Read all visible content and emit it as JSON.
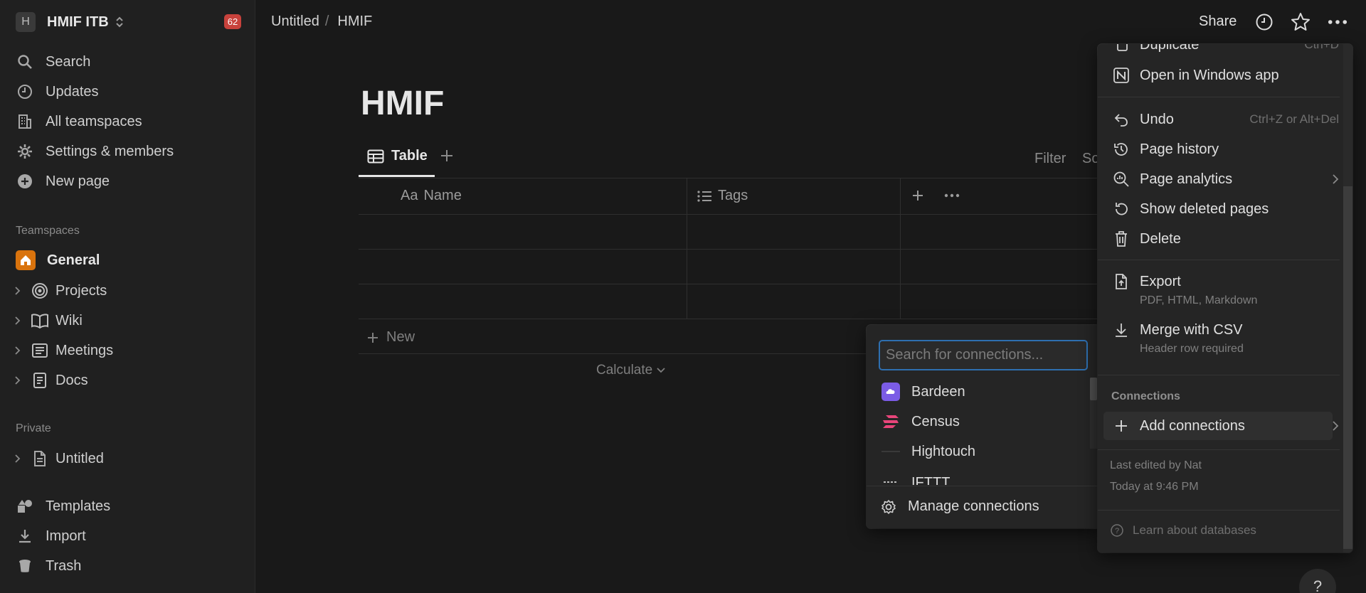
{
  "workspace": {
    "initial": "H",
    "name": "HMIF ITB",
    "badge": "62"
  },
  "sidebar": {
    "items": [
      {
        "label": "Search",
        "icon": "search-icon"
      },
      {
        "label": "Updates",
        "icon": "clock-icon"
      },
      {
        "label": "All teamspaces",
        "icon": "building-icon"
      },
      {
        "label": "Settings & members",
        "icon": "gear-icon"
      },
      {
        "label": "New page",
        "icon": "plus-circle-icon"
      }
    ],
    "teamspaces_label": "Teamspaces",
    "teamspaces": [
      {
        "label": "General",
        "icon": "home-icon"
      },
      {
        "label": "Projects",
        "icon": "target-icon"
      },
      {
        "label": "Wiki",
        "icon": "book-icon"
      },
      {
        "label": "Meetings",
        "icon": "notes-icon"
      },
      {
        "label": "Docs",
        "icon": "doc-icon"
      }
    ],
    "private_label": "Private",
    "private": [
      {
        "label": "Untitled",
        "icon": "page-icon"
      }
    ],
    "bottom": [
      {
        "label": "Templates",
        "icon": "shapes-icon"
      },
      {
        "label": "Import",
        "icon": "download-icon"
      },
      {
        "label": "Trash",
        "icon": "trash-icon"
      }
    ]
  },
  "topbar": {
    "breadcrumb": [
      "Untitled",
      "HMIF"
    ],
    "breadcrumb_sep": "/",
    "share": "Share"
  },
  "page": {
    "title": "HMIF",
    "view_tab": "Table",
    "filter": "Filter",
    "sort": "So",
    "columns": [
      {
        "label": "Name",
        "icon_text": "Aa"
      },
      {
        "label": "Tags",
        "icon": "list-icon"
      }
    ],
    "new_row": "New",
    "calculate": "Calculate"
  },
  "connections_popup": {
    "search_placeholder": "Search for connections...",
    "items": [
      {
        "label": "Bardeen",
        "color": "#7b5ce6"
      },
      {
        "label": "Census",
        "color": "#e8457a"
      },
      {
        "label": "Hightouch",
        "color": "#3a3a3a"
      },
      {
        "label": "IFTTT",
        "color": "#2a2a2a"
      }
    ],
    "manage": "Manage connections"
  },
  "page_menu": {
    "duplicate": "Duplicate",
    "duplicate_shortcut": "Ctrl+D",
    "open_windows": "Open in Windows app",
    "undo": "Undo",
    "undo_shortcut": "Ctrl+Z or Alt+Del",
    "page_history": "Page history",
    "page_analytics": "Page analytics",
    "show_deleted": "Show deleted pages",
    "delete": "Delete",
    "export": "Export",
    "export_sub": "PDF, HTML, Markdown",
    "merge": "Merge with CSV",
    "merge_sub": "Header row required",
    "connections_label": "Connections",
    "add_connections": "Add connections",
    "last_edited": "Last edited by Nat",
    "last_edited_time": "Today at 9:46 PM",
    "learn": "Learn about databases"
  },
  "help": "?"
}
